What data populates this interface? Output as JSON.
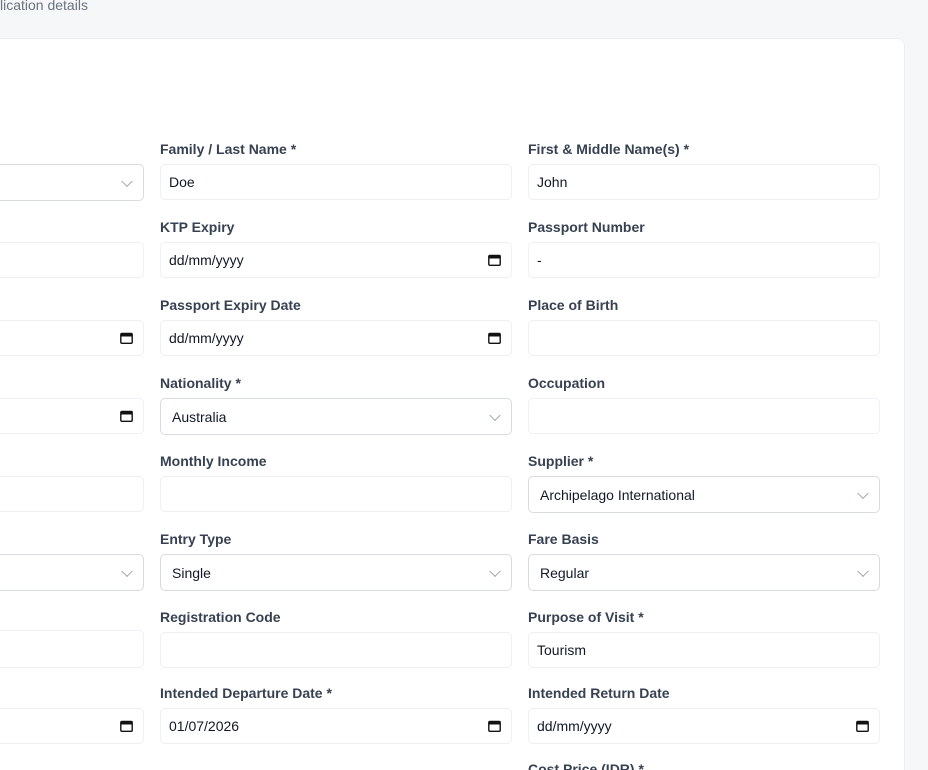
{
  "breadcrumb": "lication details",
  "col_left": {
    "fields": [
      {
        "type": "select",
        "value": ""
      },
      {
        "type": "text",
        "value": ""
      },
      {
        "type": "date",
        "value": ""
      },
      {
        "type": "date",
        "value": ""
      },
      {
        "type": "text",
        "value": ""
      },
      {
        "type": "select",
        "value": ""
      },
      {
        "type": "text",
        "value": ""
      },
      {
        "type": "date",
        "value": ""
      }
    ]
  },
  "col_middle": {
    "family_name": {
      "label": "Family / Last Name *",
      "value": "Doe"
    },
    "ktp_expiry": {
      "label": "KTP Expiry",
      "value": "dd/mm/yyyy"
    },
    "passport_expiry": {
      "label": "Passport Expiry Date",
      "value": "dd/mm/yyyy"
    },
    "nationality": {
      "label": "Nationality *",
      "value": "Australia"
    },
    "monthly_income": {
      "label": "Monthly Income",
      "value": ""
    },
    "entry_type": {
      "label": "Entry Type",
      "value": "Single"
    },
    "registration_code": {
      "label": "Registration Code",
      "value": ""
    },
    "departure_date": {
      "label": "Intended Departure Date *",
      "value": "01/07/2026"
    }
  },
  "col_right": {
    "first_name": {
      "label": "First & Middle Name(s) *",
      "value": "John"
    },
    "passport_number": {
      "label": "Passport Number",
      "value": "-"
    },
    "place_of_birth": {
      "label": "Place of Birth",
      "value": ""
    },
    "occupation": {
      "label": "Occupation",
      "value": ""
    },
    "supplier": {
      "label": "Supplier *",
      "value": "Archipelago International"
    },
    "fare_basis": {
      "label": "Fare Basis",
      "value": "Regular"
    },
    "purpose_of_visit": {
      "label": "Purpose of Visit *",
      "value": "Tourism"
    },
    "return_date": {
      "label": "Intended Return Date",
      "value": "dd/mm/yyyy"
    },
    "cost_price": {
      "label": "Cost Price (IDR) *"
    }
  },
  "icons": {
    "dropdown": "chevron-down-icon",
    "date": "calendar-icon"
  }
}
